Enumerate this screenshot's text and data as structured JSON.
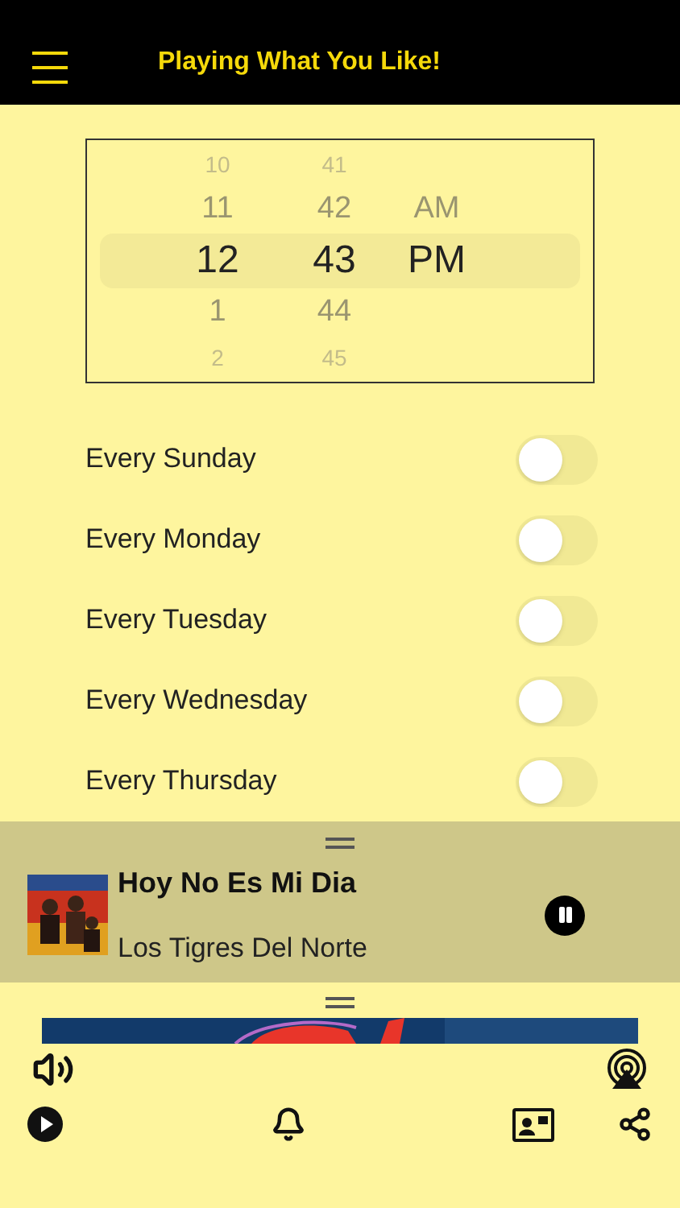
{
  "header": {
    "title": "Playing What You Like!"
  },
  "time_picker": {
    "hours": [
      {
        "label": "10",
        "selected": false
      },
      {
        "label": "11",
        "selected": false
      },
      {
        "label": "12",
        "selected": true
      },
      {
        "label": "1",
        "selected": false
      },
      {
        "label": "2",
        "selected": false
      }
    ],
    "minutes": [
      {
        "label": "41",
        "selected": false
      },
      {
        "label": "42",
        "selected": false
      },
      {
        "label": "43",
        "selected": true
      },
      {
        "label": "44",
        "selected": false
      },
      {
        "label": "45",
        "selected": false
      }
    ],
    "periods": [
      {
        "label": "AM",
        "selected": false
      },
      {
        "label": "PM",
        "selected": true
      }
    ]
  },
  "schedule": [
    {
      "label": "Every Sunday",
      "on": false
    },
    {
      "label": "Every Monday",
      "on": false
    },
    {
      "label": "Every Tuesday",
      "on": false
    },
    {
      "label": "Every Wednesday",
      "on": false
    },
    {
      "label": "Every Thursday",
      "on": false
    }
  ],
  "now_playing": {
    "title": "Hoy No Es Mi Dia",
    "artist": "Los Tigres Del Norte",
    "playing": true
  }
}
